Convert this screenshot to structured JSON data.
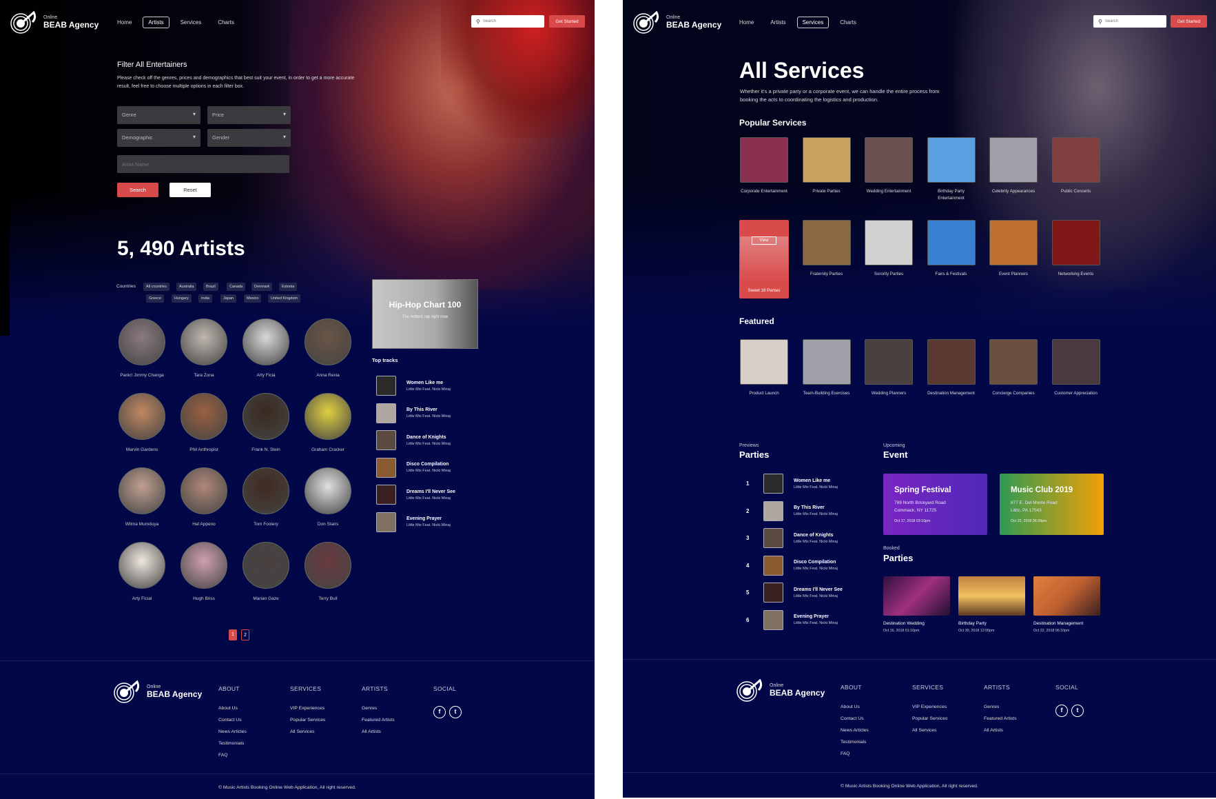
{
  "brand": {
    "small": "Online",
    "name": "BEAB Agency"
  },
  "nav": {
    "items": [
      "Home",
      "Artists",
      "Services",
      "Charts"
    ],
    "search_placeholder": "Search",
    "cta": "Get Started"
  },
  "artists_page": {
    "active_nav": "Artists",
    "filter": {
      "title": "Filter All Entertainers",
      "description": "Please check off the genres, prices and demographics that best suit your event, in order to get a more accurate result, feel free to choose multiple options in each filter box.",
      "selects": [
        "Genre",
        "Price",
        "Demographic",
        "Gender"
      ],
      "artist_name_placeholder": "Artist Name",
      "search_label": "Search",
      "reset_label": "Reset"
    },
    "count": "5, 490 Artists",
    "countries_label": "Countries",
    "countries": [
      "All countries",
      "Australia",
      "Brazil",
      "Canada",
      "Denmark",
      "Estonia",
      "Greece",
      "Hungary",
      "India",
      "Japan",
      "Mexico",
      "United Kingdom"
    ],
    "artists": [
      "Panic! Jimmy Changa",
      "Tara Zona",
      "Arty Ficia",
      "Anna Rexia",
      "Marvin Gardens",
      "Phil Anthropist",
      "Frank N. Stein",
      "Graham Cracker",
      "Wilma Mumduya",
      "Hal Appeno",
      "Tom Foolery",
      "Don Stairs",
      "Arty Ficial",
      "Hugh Briss",
      "Marian Gaze",
      "Terry Bull"
    ],
    "pagination": [
      "1",
      "2"
    ],
    "chart_card": {
      "title": "Hip-Hop Chart 100",
      "subtitle": "The hottest rap right now"
    },
    "top_tracks_label": "Top tracks",
    "tracks": [
      {
        "title": "Women Like me",
        "artist": "Little Mix Feat. Nicki Minaj"
      },
      {
        "title": "By This River",
        "artist": "Little Mix Feat. Nicki Minaj"
      },
      {
        "title": "Dance of Knights",
        "artist": "Little Mix Feat. Nicki Minaj"
      },
      {
        "title": "Disco Compilation",
        "artist": "Little Mix Feat. Nicki Minaj"
      },
      {
        "title": "Dreams I'll Never See",
        "artist": "Little Mix Feat. Nicki Minaj"
      },
      {
        "title": "Evening Prayer",
        "artist": "Little Mix Feat. Nicki Minaj"
      }
    ]
  },
  "services_page": {
    "active_nav": "Services",
    "title": "All Services",
    "description": "Whether it's a private party or a corporate event, we can handle the entire process from booking the acts to coordinating the logistics and production.",
    "popular_label": "Popular Services",
    "popular": [
      "Corporate Entertainment",
      "Private Parties",
      "Wedding Entertainment",
      "Birthday Party Entertainment",
      "Celebrity Appearances",
      "Public Concerts",
      "Sweet 16 Parties",
      "Fraternity Parties",
      "Sorority Parties",
      "Fairs & Festivals",
      "Event Planners",
      "Networking Events"
    ],
    "highlighted_view_label": "View",
    "featured_label": "Featured",
    "featured": [
      "Product Launch",
      "Team-Building Exercises",
      "Wedding Planners",
      "Destination Management",
      "Concierge Companies",
      "Customer Appreciation"
    ],
    "previews_small": "Previews",
    "previews_big": "Parties",
    "ranked": [
      {
        "rank": "1",
        "title": "Women Like me",
        "artist": "Little Mix Feat. Nicki Minaj"
      },
      {
        "rank": "2",
        "title": "By This River",
        "artist": "Little Mix Feat. Nicki Minaj"
      },
      {
        "rank": "3",
        "title": "Dance of Knights",
        "artist": "Little Mix Feat. Nicki Minaj"
      },
      {
        "rank": "4",
        "title": "Disco Compilation",
        "artist": "Little Mix Feat. Nicki Minaj"
      },
      {
        "rank": "5",
        "title": "Dreams I'll Never See",
        "artist": "Little Mix Feat. Nicki Minaj"
      },
      {
        "rank": "6",
        "title": "Evening Prayer",
        "artist": "Little Mix Feat. Nicki Minaj"
      }
    ],
    "upcoming_small": "Upcoming",
    "upcoming_big": "Event",
    "events": [
      {
        "name": "Spring Festival",
        "addr1": "789 North Brickyard Road",
        "addr2": "Commack, NY 11725",
        "date": "Oct 17, 2018 03:10pm",
        "color_from": "#7a26c1",
        "color_to": "#4f28b8"
      },
      {
        "name": "Music Club 2019",
        "addr1": "877 E. Del Monte Road",
        "addr2": "Lititz, PA 17543",
        "date": "Oct 22, 2018 06:30pm",
        "color_from": "#2f9a52",
        "color_to": "#f2a007"
      }
    ],
    "booked_small": "Booked",
    "booked_big": "Parties",
    "booked": [
      {
        "name": "Destination Wedding",
        "date": "Oct 16, 2018 01:10pm"
      },
      {
        "name": "Birthday Party",
        "date": "Oct 30, 2018 12:00pm"
      },
      {
        "name": "Destination Management",
        "date": "Oct 22, 2018 06:10pm"
      }
    ]
  },
  "footer": {
    "columns": [
      {
        "title": "ABOUT",
        "links": [
          "About Us",
          "Contact Us",
          "News Articles",
          "Testimonials",
          "FAQ"
        ]
      },
      {
        "title": "SERVICES",
        "links": [
          "VIP Experiences",
          "Popular Services",
          "All Services"
        ]
      },
      {
        "title": "ARTISTS",
        "links": [
          "Genres",
          "Featured Artists",
          "All Artists"
        ]
      },
      {
        "title": "SOCIAL",
        "links": []
      }
    ],
    "social": [
      {
        "icon": "facebook-icon",
        "glyph": "f"
      },
      {
        "icon": "twitter-icon",
        "glyph": "t"
      }
    ],
    "copyright": "© Music Artists Booking Online Web Application, All right reserved."
  },
  "colors": {
    "accent": "#d94a4a",
    "background": "#020747"
  }
}
